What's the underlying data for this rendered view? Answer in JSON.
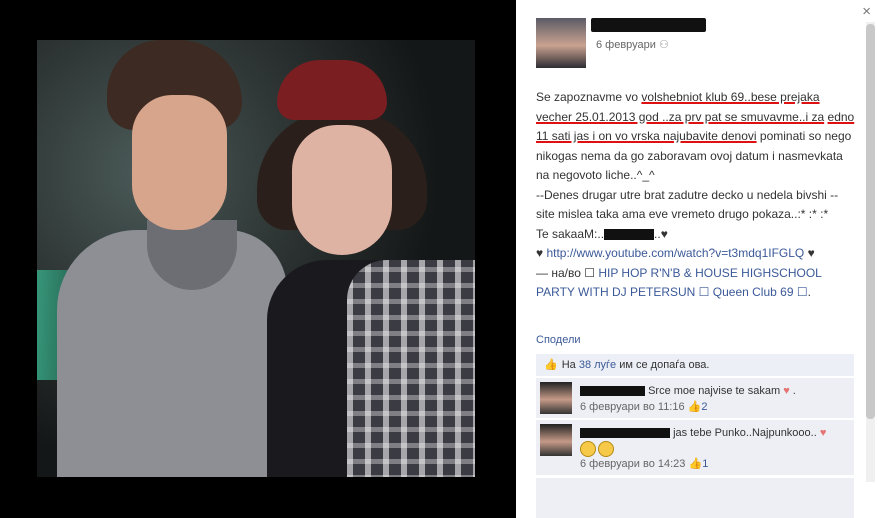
{
  "panel": {
    "close_label": "×",
    "post": {
      "date": "6 февруари",
      "privacy_icon": "friends-icon",
      "line1_pre": "Se zapoznavme vo ",
      "line1_underlined": "volshebniot klub 69..bese prejaka",
      "line2_underlined": "vecher 25.01.2013 god ..za prv pat se smuvavme..i za",
      "line3_underlined": "edno 11 sati jas i on vo vrska najubavite denovi",
      "line4": "pominati so nego nikogas nema da go zaboravam ovoj datum i nasmevkata na negovoto liche..^_^",
      "line5": "--Denes drugar utre brat zadutre decko u nedela bivshi --",
      "line6": "site mislea taka ama eve vremeto drugo pokaza..:* :* :*",
      "line7_pre": "Te sakaaM:..",
      "line7_post": "..♥",
      "link_pre": "♥ ",
      "link_text": "http://www.youtube.com/watch?v=t3mdq1IFGLQ",
      "link_post": " ♥",
      "tag_pre": "— на/во ☐ ",
      "tag_text": "HIP HOP R'N'B & HOUSE HIGHSCHOOL PARTY WITH DJ PETERSUN ☐ Queen Club 69 ☐",
      "tag_post": "."
    },
    "share_label": "Сподели",
    "likes": {
      "pre": "На ",
      "count_link": "38 луѓе",
      "post": " им се допаѓа ова."
    },
    "comments": [
      {
        "text": "Srce moe najvise te sakam",
        "emoji": "♥",
        "time": "6 февруари во 11:16",
        "likes": "2"
      },
      {
        "text": "jas tebe Punko..Najpunkooo..",
        "emoji": "♥",
        "time": "6 февруари во 14:23",
        "likes": "1"
      }
    ]
  },
  "colors": {
    "link": "#3b5998",
    "underline": "#dd1111"
  }
}
